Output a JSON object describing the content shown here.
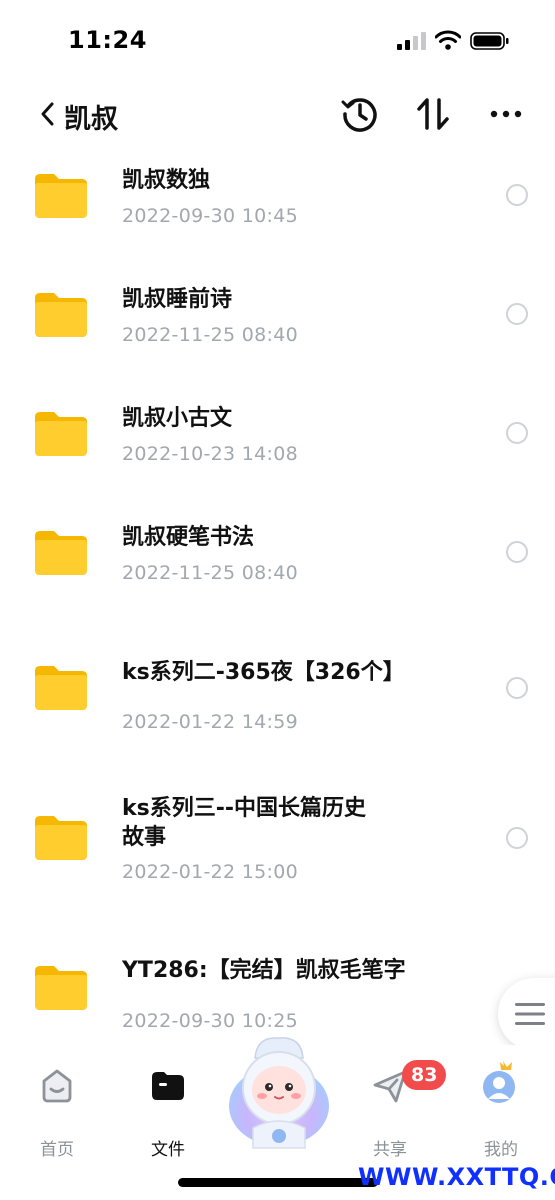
{
  "status_bar": {
    "time": "11:24"
  },
  "nav": {
    "title": "凯叔"
  },
  "files": [
    {
      "name": "凯叔数独",
      "date": "2022-09-30 10:45"
    },
    {
      "name": "凯叔睡前诗",
      "date": "2022-11-25 08:40"
    },
    {
      "name": "凯叔小古文",
      "date": "2022-10-23 14:08"
    },
    {
      "name": "凯叔硬笔书法",
      "date": "2022-11-25 08:40"
    },
    {
      "name": "ks系列二-365夜【326个】",
      "date": "2022-01-22 14:59"
    },
    {
      "name_line1": "ks系列三--中国长篇历史",
      "name_line2": "故事",
      "date": "2022-01-22 15:00"
    },
    {
      "name": "YT286:【完结】凯叔毛笔字",
      "date": "2022-09-30 10:25"
    }
  ],
  "tabs": {
    "home": "首页",
    "files": "文件",
    "share": "共享",
    "mine": "我的"
  },
  "share_badge": "83",
  "watermark": "WWW.XXTTQ.COM",
  "colors": {
    "folder": "#ffcd2e",
    "date_text": "#a3a7ae",
    "badge": "#f24b4b",
    "watermark": "#1030ff"
  }
}
